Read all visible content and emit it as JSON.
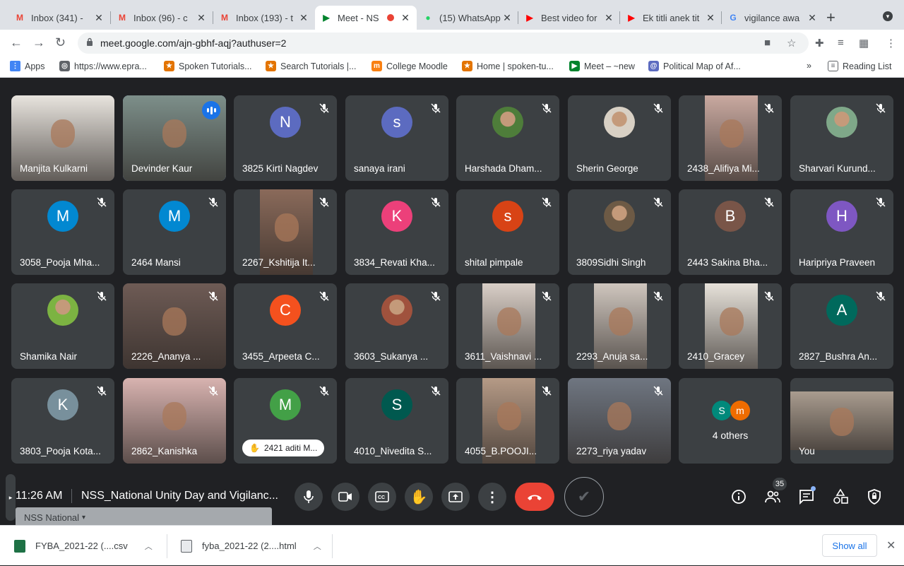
{
  "tabs": [
    {
      "title": "Inbox (341) - ",
      "icon": "gmail-icon"
    },
    {
      "title": "Inbox (96) - c",
      "icon": "gmail-icon"
    },
    {
      "title": "Inbox (193) - t",
      "icon": "gmail-icon"
    },
    {
      "title": "Meet - NS",
      "icon": "meet-icon",
      "active": true
    },
    {
      "title": "(15) WhatsApp",
      "icon": "whatsapp-icon",
      "badge": "15"
    },
    {
      "title": "Best video for",
      "icon": "youtube-icon"
    },
    {
      "title": "Ek titli anek tit",
      "icon": "youtube-icon"
    },
    {
      "title": "vigilance awa",
      "icon": "google-icon"
    }
  ],
  "address": {
    "url": "meet.google.com/ajn-gbhf-aqj?authuser=2"
  },
  "bookmarks": [
    {
      "label": "Apps",
      "icon": "apps-grid-icon"
    },
    {
      "label": "https://www.epra...",
      "icon": "globe-icon"
    },
    {
      "label": "Spoken Tutorials...",
      "icon": "spoken-tutorial-icon"
    },
    {
      "label": "Search Tutorials |...",
      "icon": "spoken-tutorial-icon"
    },
    {
      "label": "College Moodle",
      "icon": "moodle-icon"
    },
    {
      "label": "Home | spoken-tu...",
      "icon": "spoken-tutorial-icon"
    },
    {
      "label": "Meet – ~new",
      "icon": "meet-icon"
    },
    {
      "label": "Political Map of Af...",
      "icon": "at-icon"
    }
  ],
  "reading_list": "Reading List",
  "tiles": [
    {
      "name": "Manjita Kulkarni",
      "kind": "video",
      "color": "#e8e4de",
      "muted": false
    },
    {
      "name": "Devinder Kaur",
      "kind": "video",
      "color": "#7d8f8a",
      "muted": false,
      "speaking": true
    },
    {
      "name": "3825 Kirti Nagdev",
      "kind": "letter",
      "letter": "N",
      "color": "#5c6bc0",
      "muted": true
    },
    {
      "name": "sanaya irani",
      "kind": "letter",
      "letter": "s",
      "color": "#5c6bc0",
      "muted": true
    },
    {
      "name": "Harshada Dham...",
      "kind": "photo",
      "color": "#4e7d3a",
      "muted": true
    },
    {
      "name": "Sherin George",
      "kind": "photo",
      "color": "#d8d0c4",
      "muted": true
    },
    {
      "name": "2438_Alifiya Mi...",
      "kind": "video",
      "color": "#c9a9a0",
      "muted": true
    },
    {
      "name": "Sharvari Kurund...",
      "kind": "photo",
      "color": "#7fa889",
      "muted": true
    },
    {
      "name": "3058_Pooja Mha...",
      "kind": "letter",
      "letter": "M",
      "color": "#0288d1",
      "muted": true
    },
    {
      "name": "2464 Mansi",
      "kind": "letter",
      "letter": "M",
      "color": "#0288d1",
      "muted": true
    },
    {
      "name": "2267_Kshitija It...",
      "kind": "video",
      "color": "#8a6a5a",
      "muted": true
    },
    {
      "name": "3834_Revati Kha...",
      "kind": "letter",
      "letter": "K",
      "color": "#ec407a",
      "muted": true
    },
    {
      "name": "shital pimpale",
      "kind": "letter",
      "letter": "s",
      "color": "#d84315",
      "muted": true
    },
    {
      "name": "3809Sidhi Singh",
      "kind": "photo",
      "color": "#6d5a45",
      "muted": true
    },
    {
      "name": "2443 Sakina Bha...",
      "kind": "letter",
      "letter": "B",
      "color": "#795548",
      "muted": true
    },
    {
      "name": "Haripriya Praveen",
      "kind": "letter",
      "letter": "H",
      "color": "#7e57c2",
      "muted": true
    },
    {
      "name": "Shamika Nair",
      "kind": "photo",
      "color": "#7cb342",
      "muted": true
    },
    {
      "name": "2226_Ananya ...",
      "kind": "video",
      "color": "#6e5b55",
      "muted": true
    },
    {
      "name": "3455_Arpeeta C...",
      "kind": "letter",
      "letter": "C",
      "color": "#f4511e",
      "muted": true
    },
    {
      "name": "3603_Sukanya ...",
      "kind": "photo",
      "color": "#a0523d",
      "muted": true
    },
    {
      "name": "3611_Vaishnavi ...",
      "kind": "video",
      "color": "#d9cfc7",
      "muted": true
    },
    {
      "name": "2293_Anuja sa...",
      "kind": "video",
      "color": "#cfc6be",
      "muted": true
    },
    {
      "name": "2410_Gracey",
      "kind": "video",
      "color": "#e7e2da",
      "muted": true
    },
    {
      "name": "2827_Bushra An...",
      "kind": "letter",
      "letter": "A",
      "color": "#00695c",
      "muted": true
    },
    {
      "name": "3803_Pooja Kota...",
      "kind": "letter",
      "letter": "K",
      "color": "#78909c",
      "muted": true
    },
    {
      "name": "2862_Kanishka",
      "kind": "video",
      "color": "#d8b3b0",
      "muted": true
    },
    {
      "name": "2421 aditi M...",
      "kind": "letter",
      "letter": "M",
      "color": "#43a047",
      "muted": true,
      "hand": true
    },
    {
      "name": "4010_Nivedita S...",
      "kind": "letter",
      "letter": "S",
      "color": "#00594f",
      "muted": true
    },
    {
      "name": "4055_B.POOJI...",
      "kind": "video",
      "color": "#b59a86",
      "muted": true
    },
    {
      "name": "2273_riya yadav",
      "kind": "video",
      "color": "#6f7681",
      "muted": true
    },
    {
      "name": "4 others",
      "kind": "others",
      "letters": [
        "S",
        "m"
      ],
      "colors": [
        "#00897b",
        "#ef6c00"
      ],
      "muted": false
    },
    {
      "name": "You",
      "kind": "video",
      "color": "#a99c8f",
      "muted": false
    }
  ],
  "controls": {
    "time": "11:26 AM",
    "meeting_title": "NSS_National Unity Day and Vigilanc...",
    "participants_count": "35",
    "ghost_label": "NSS National"
  },
  "downloads": [
    {
      "filename": "FYBA_2021-22 (....csv",
      "icon": "excel-file-icon"
    },
    {
      "filename": "fyba_2021-22 (2....html",
      "icon": "html-file-icon"
    }
  ],
  "show_all": "Show all"
}
